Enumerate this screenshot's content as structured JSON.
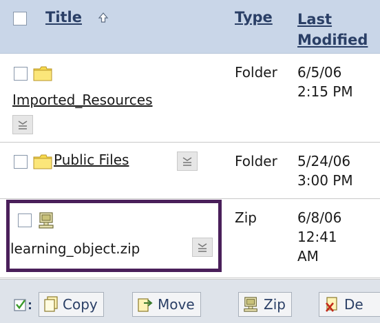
{
  "header": {
    "title": "Title",
    "type": "Type",
    "last_modified": "Last\nModified"
  },
  "rows": [
    {
      "name": "Imported_Resources",
      "type": "Folder",
      "modified": "6/5/06\n2:15 PM",
      "icon": "folder-icon"
    },
    {
      "name": "Public Files",
      "type": "Folder",
      "modified": "5/24/06\n3:00 PM",
      "icon": "folder-icon"
    },
    {
      "name": "learning_object.zip",
      "type": "Zip",
      "modified": "6/8/06\n12:41\nAM",
      "icon": "zip-file-icon"
    }
  ],
  "toolbar": {
    "copy": "Copy",
    "move": "Move",
    "zip": "Zip",
    "delete": "De"
  },
  "colors": {
    "header_bg": "#c9d6e8",
    "link": "#2a3f66",
    "highlight_border": "#4a1f5a",
    "folder_yellow": "#f7d94c"
  }
}
